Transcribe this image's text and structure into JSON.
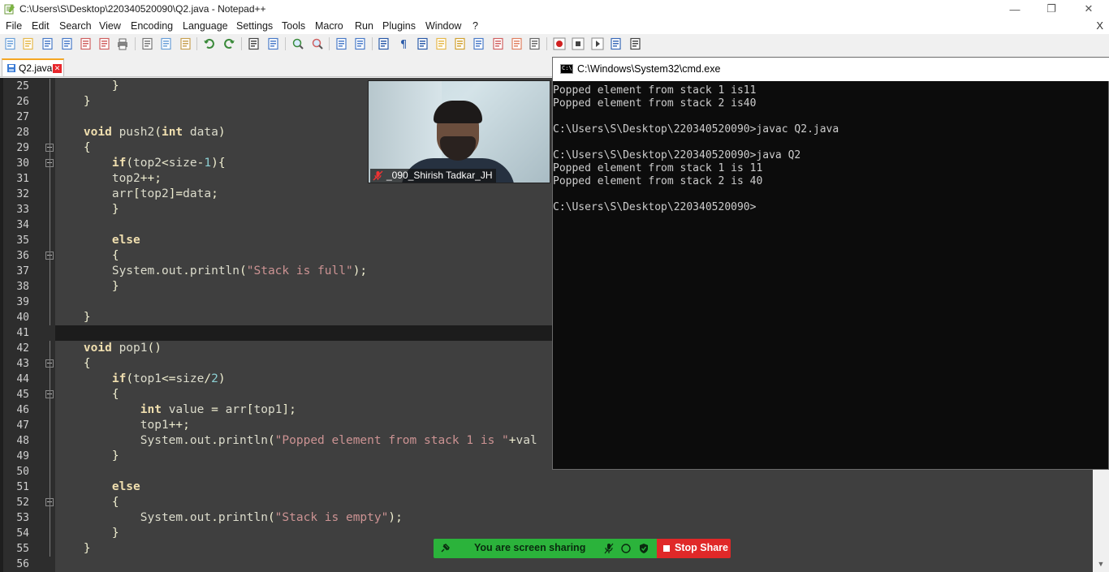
{
  "window": {
    "title": "C:\\Users\\S\\Desktop\\220340520090\\Q2.java - Notepad++",
    "minimize_glyph": "—",
    "restore_glyph": "❐",
    "close_glyph": "✕"
  },
  "menu": {
    "items": [
      "File",
      "Edit",
      "Search",
      "View",
      "Encoding",
      "Language",
      "Settings",
      "Tools",
      "Macro",
      "Run",
      "Plugins",
      "Window",
      "?"
    ],
    "close_doc_glyph": "X"
  },
  "toolbar": {
    "icons": [
      "new-file-icon",
      "open-file-icon",
      "save-icon",
      "save-all-icon",
      "close-icon",
      "close-all-icon",
      "print-icon",
      "cut-icon",
      "copy-icon",
      "paste-icon",
      "undo-icon",
      "redo-icon",
      "find-icon",
      "replace-icon",
      "zoom-in-icon",
      "zoom-out-icon",
      "sync-vertical-icon",
      "sync-horizontal-icon",
      "word-wrap-icon",
      "show-all-chars-icon",
      "indent-guide-icon",
      "function-list-icon",
      "document-map-icon",
      "folder-workspace-icon",
      "doc-list-icon",
      "folder-icon",
      "monitoring-icon",
      "record-macro-icon",
      "stop-macro-icon",
      "play-macro-icon",
      "run-macro-multiple-icon",
      "save-macro-icon"
    ]
  },
  "tabs": [
    {
      "label": "Q2.java",
      "close_glyph": "✕"
    }
  ],
  "editor": {
    "current_line": 41,
    "lines": [
      {
        "num": "25",
        "text": "        }"
      },
      {
        "num": "26",
        "text": "    }"
      },
      {
        "num": "27",
        "text": ""
      },
      {
        "num": "28",
        "text": "    void push2(int data)"
      },
      {
        "num": "29",
        "text": "    {"
      },
      {
        "num": "30",
        "text": "        if(top2<size-1){"
      },
      {
        "num": "31",
        "text": "        top2++;"
      },
      {
        "num": "32",
        "text": "        arr[top2]=data;"
      },
      {
        "num": "33",
        "text": "        }"
      },
      {
        "num": "34",
        "text": ""
      },
      {
        "num": "35",
        "text": "        else"
      },
      {
        "num": "36",
        "text": "        {"
      },
      {
        "num": "37",
        "text": "        System.out.println(\"Stack is full\");"
      },
      {
        "num": "38",
        "text": "        }"
      },
      {
        "num": "39",
        "text": ""
      },
      {
        "num": "40",
        "text": "    }"
      },
      {
        "num": "41",
        "text": ""
      },
      {
        "num": "42",
        "text": "    void pop1()"
      },
      {
        "num": "43",
        "text": "    {"
      },
      {
        "num": "44",
        "text": "        if(top1<=size/2)"
      },
      {
        "num": "45",
        "text": "        {"
      },
      {
        "num": "46",
        "text": "            int value = arr[top1];"
      },
      {
        "num": "47",
        "text": "            top1++;"
      },
      {
        "num": "48",
        "text": "            System.out.println(\"Popped element from stack 1 is \"+val"
      },
      {
        "num": "49",
        "text": "        }"
      },
      {
        "num": "50",
        "text": ""
      },
      {
        "num": "51",
        "text": "        else"
      },
      {
        "num": "52",
        "text": "        {"
      },
      {
        "num": "53",
        "text": "            System.out.println(\"Stack is empty\");"
      },
      {
        "num": "54",
        "text": "        }"
      },
      {
        "num": "55",
        "text": "    }"
      },
      {
        "num": "56",
        "text": ""
      }
    ],
    "scroll_up_glyph": "▲",
    "scroll_down_glyph": "▼"
  },
  "cmd": {
    "title": "C:\\Windows\\System32\\cmd.exe",
    "lines": [
      "Popped element from stack 1 is11",
      "Popped element from stack 2 is40",
      "",
      "C:\\Users\\S\\Desktop\\220340520090>javac Q2.java",
      "",
      "C:\\Users\\S\\Desktop\\220340520090>java Q2",
      "Popped element from stack 1 is 11",
      "Popped element from stack 2 is 40",
      "",
      "C:\\Users\\S\\Desktop\\220340520090>"
    ]
  },
  "video": {
    "participant_name": "_090_Shirish Tadkar_JH"
  },
  "share": {
    "status_text": "You are screen sharing",
    "stop_label": "Stop Share",
    "colors": {
      "green": "#2bb33b",
      "red": "#e02828"
    }
  }
}
